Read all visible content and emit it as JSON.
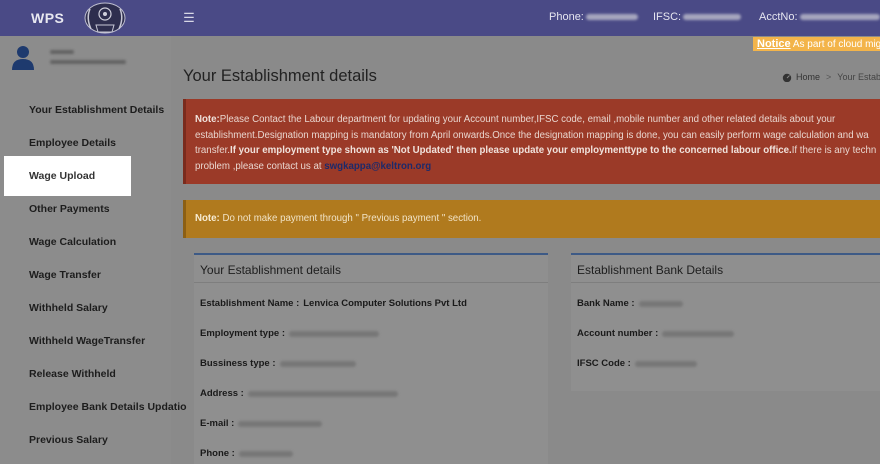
{
  "header": {
    "brand": "WPS",
    "phone_label": "Phone:",
    "ifsc_label": "IFSC:",
    "acct_label": "AcctNo:"
  },
  "notice": {
    "label": "Notice",
    "text": " As part of cloud mig"
  },
  "sidebar": {
    "items": [
      {
        "label": "Your Establishment Details"
      },
      {
        "label": "Employee Details"
      },
      {
        "label": "Wage Upload"
      },
      {
        "label": "Other Payments"
      },
      {
        "label": "Wage Calculation"
      },
      {
        "label": "Wage Transfer"
      },
      {
        "label": "Withheld Salary"
      },
      {
        "label": "Withheld WageTransfer"
      },
      {
        "label": "Release Withheld"
      },
      {
        "label": "Employee Bank Details Updatio"
      },
      {
        "label": "Previous Salary"
      }
    ],
    "active_index": 2
  },
  "main": {
    "title": "Your Establishment details",
    "breadcrumb": {
      "home": "Home",
      "current": "Your Establi"
    },
    "alert_red": {
      "note_label": "Note:",
      "text1": "Please Contact the Labour department for updating your Account number,IFSC code, email ,mobile number and other related details about your establishment.Designation mapping is mandatory from April onwards.Once the designation mapping is done, you can easily perform wage calculation and wa transfer.",
      "bold_text": "If your employment type shown as 'Not Updated' then please update your employmenttype to the concerned labour office.",
      "text2": "If there is any techn problem ,please contact us at ",
      "email": "swgkappa@keltron.org"
    },
    "alert_orange": {
      "note_label": "Note:",
      "text": " Do not make payment through \" Previous payment \" section."
    },
    "establishment_panel": {
      "title": "Your Establishment details",
      "name_label": "Establishment Name :",
      "name_value": "Lenvica Computer Solutions Pvt Ltd",
      "employment_label": "Employment type :",
      "business_label": "Bussiness type :",
      "address_label": "Address :",
      "email_label": "E-mail :",
      "phone_label": "Phone :"
    },
    "bank_panel": {
      "title": "Establishment Bank Details",
      "bank_label": "Bank Name :",
      "account_label": "Account number :",
      "ifsc_label": "IFSC Code :"
    }
  }
}
